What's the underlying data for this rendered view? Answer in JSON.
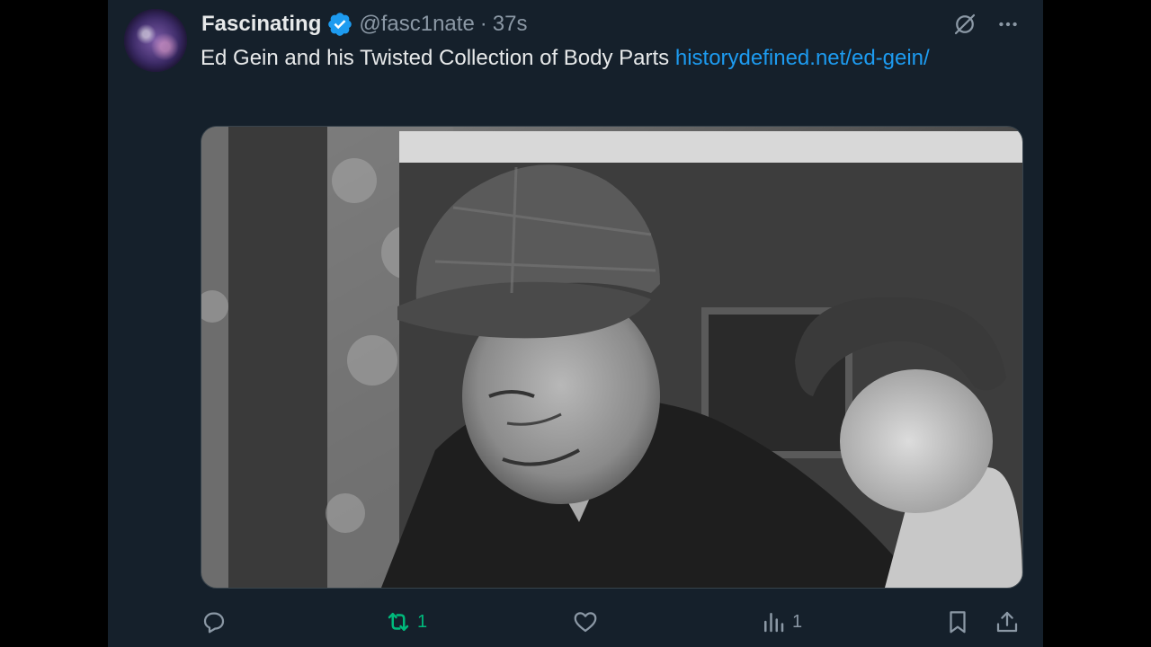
{
  "tweet": {
    "author_name": "Fascinating",
    "handle": "@fasc1nate",
    "separator": "·",
    "time": "37s",
    "text": "Ed Gein and his Twisted Collection of Body Parts ",
    "link_text": "historydefined.net/ed-gein/"
  },
  "actions": {
    "reply_count": "",
    "retweet_count": "1",
    "like_count": "",
    "views_count": "1"
  },
  "icons": {
    "verified": "verified-badge-icon",
    "grok": "grok-icon",
    "more": "more-icon",
    "reply": "reply-icon",
    "retweet": "retweet-icon",
    "like": "heart-icon",
    "views": "views-icon",
    "bookmark": "bookmark-icon",
    "share": "share-icon"
  },
  "colors": {
    "background": "#15202b",
    "text": "#e7e9ea",
    "muted": "#8b98a5",
    "link": "#1d9bf0",
    "retweet_active": "#00ba7c",
    "verified": "#1d9bf0"
  }
}
